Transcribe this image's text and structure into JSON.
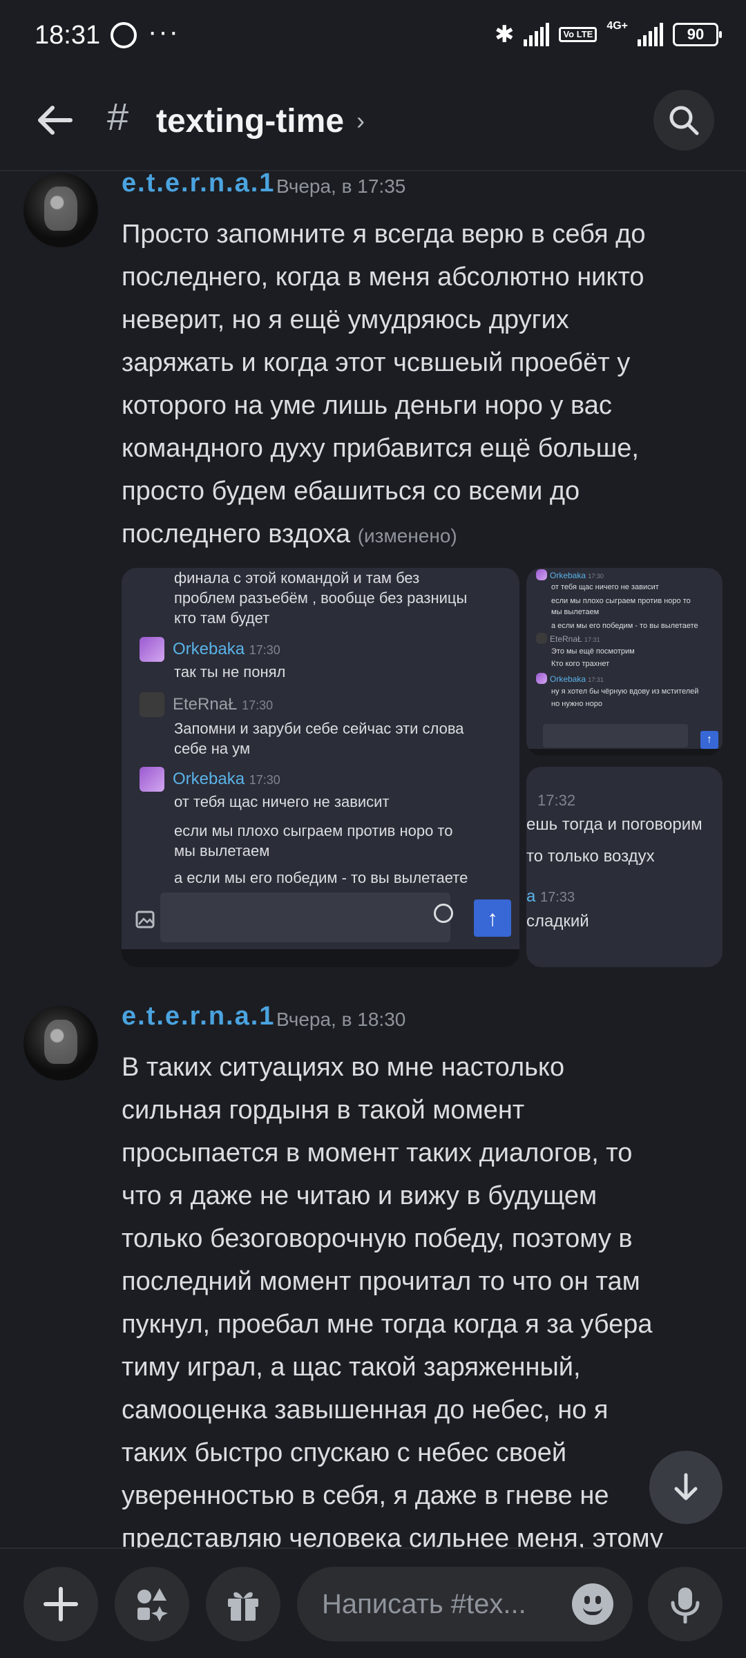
{
  "status_bar": {
    "time": "18:31",
    "dots": "···",
    "volte": "Vo LTE",
    "network": "4G+",
    "battery": "90"
  },
  "header": {
    "channel_name": "texting-time",
    "hash": "#",
    "chevron": "›"
  },
  "messages": [
    {
      "author": "e.t.e.r.n.a.1",
      "timestamp": "Вчера, в 17:35",
      "lines": [
        "Просто запомните я всегда верю в себя до",
        "последнего, когда в меня абсолютно никто",
        "неверит, но я ещё умудряюсь других",
        "заряжать и когда этот чсвшеый проебёт у",
        "которого на уме лишь деньги норо у вас",
        "командного духу прибавится ещё больше,",
        "просто будем ебашиться со всеми до",
        "последнего вздоха"
      ],
      "edited": "(изменено)"
    },
    {
      "author": "e.t.e.r.n.a.1",
      "timestamp": "Вчера, в 18:30",
      "lines": [
        "В таких ситуациях во мне настолько",
        "сильная гордыня в такой момент",
        "просыпается в момент таких диалогов, то",
        "что я даже не читаю и вижу в будущем",
        "только безоговорочную победу,   поэтому в",
        "последний момент прочитал то что он там",
        "пукнул, проебал мне тогда когда я за убера",
        "тиму играл, а щас такой заряженный,",
        "самооценка завышенная до небес, но я",
        "таких быстро спускаю с небес своей",
        "уверенностью в себя, я даже в гневе не",
        "представляю человека сильнее меня, этому"
      ]
    }
  ],
  "attachment1": {
    "top_lines": [
      "финала с этой командой и там без",
      "проблем разъебём , вообще без разницы",
      "кто там будет"
    ],
    "m1_name": "Orkebaka",
    "m1_time": "17:30",
    "m1_text": "так ты не понял",
    "m2_name": "EteRnaŁ",
    "m2_time": "17:30",
    "m2_text": [
      "Запомни и заруби себе сейчас эти слова",
      "себе на ум"
    ],
    "m3_name": "Orkebaka",
    "m3_time": "17:30",
    "m3_lines": [
      "от тебя щас ничего не зависит",
      "если мы плохо сыграем против норо то",
      "мы вылетаем",
      "а если мы его победим - то вы вылетаете"
    ]
  },
  "attachment2": {
    "m1_name": "Orkebaka",
    "m1_time": "17:30",
    "m1_lines": [
      "от тебя щас ничего не зависит",
      "если мы плохо сыграем против норо то",
      "мы вылетаем",
      "а если мы его победим - то вы вылетаете"
    ],
    "m2_name": "EteRnaŁ",
    "m2_time": "17:31",
    "m2_lines": [
      "Это мы ещё посмотрим",
      "Кто кого трахнет"
    ],
    "m3_name": "Orkebaka",
    "m3_time": "17:31",
    "m3_lines": [
      "ну я хотел бы чёрную вдову из мстителей",
      "но нужно норо"
    ]
  },
  "attachment3": {
    "time1": "17:32",
    "line1": "ешь тогда и поговорим",
    "line2": "то только воздух",
    "name_frag": "а",
    "time2": "17:33",
    "line3": "сладкий"
  },
  "composer": {
    "placeholder": "Написать #tex..."
  },
  "colors": {
    "background": "#1c1d22",
    "author": "#4aa3df",
    "accent": "#3867d6"
  }
}
